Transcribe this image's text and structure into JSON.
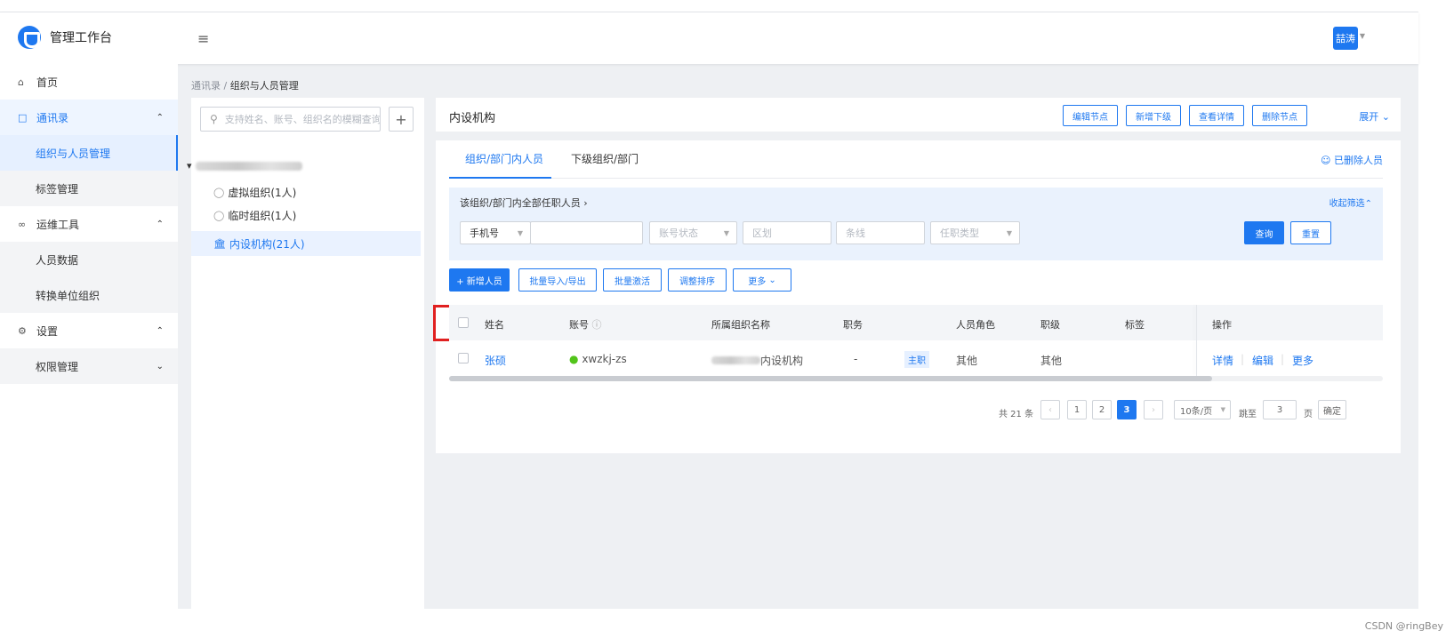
{
  "app": {
    "title": "管理工作台",
    "user": "喆涛"
  },
  "sidebar": {
    "items": [
      {
        "label": "首页",
        "icon": "home-icon"
      },
      {
        "label": "通讯录",
        "icon": "contacts-icon"
      },
      {
        "label": "组织与人员管理"
      },
      {
        "label": "标签管理"
      },
      {
        "label": "运维工具",
        "icon": "link-icon"
      },
      {
        "label": "人员数据"
      },
      {
        "label": "转换单位组织"
      },
      {
        "label": "设置",
        "icon": "gear-icon"
      },
      {
        "label": "权限管理"
      }
    ]
  },
  "breadcrumb": {
    "parent": "通讯录",
    "sep": " / ",
    "current": "组织与人员管理"
  },
  "tree": {
    "search_placeholder": "支持姓名、账号、组织名的模糊查询",
    "nodes": [
      "虚拟组织(1人)",
      "临时组织(1人)",
      "内设机构(21人)"
    ]
  },
  "header": {
    "title": "内设机构",
    "buttons": [
      "编辑节点",
      "新增下级",
      "查看详情",
      "删除节点"
    ],
    "expand": "展开"
  },
  "tabs": [
    "组织/部门内人员",
    "下级组织/部门"
  ],
  "deleted_link": "已删除人员",
  "filter": {
    "title": "该组织/部门内全部任职人员",
    "collapse": "收起筛选",
    "phone_select": "手机号",
    "account_status": "账号状态",
    "district": "区划",
    "line": "条线",
    "job_type": "任职类型",
    "query": "查询",
    "reset": "重置"
  },
  "toolbar": [
    "+ 新增人员",
    "批量导入/导出",
    "批量激活",
    "调整排序",
    "更多"
  ],
  "table": {
    "columns": [
      "姓名",
      "账号",
      "所属组织名称",
      "职务",
      "人员角色",
      "职级",
      "标签",
      "操作"
    ],
    "rows": [
      {
        "name": "张硕",
        "account": "xwzkj-zs",
        "org": "内设机构",
        "duty": "-",
        "badge": "主职",
        "role": "其他",
        "rank": "其他",
        "actions": [
          "详情",
          "编辑",
          "更多"
        ]
      }
    ]
  },
  "pagination": {
    "total": "共 21 条",
    "pages": [
      "1",
      "2",
      "3"
    ],
    "page_size": "10条/页",
    "jump_label": "跳至",
    "jump_value": "3",
    "page_unit": "页",
    "confirm": "确定"
  },
  "watermark": "CSDN @ringBey",
  "colors": {
    "accent": "#1e78f0",
    "highlight": "#e02020"
  }
}
